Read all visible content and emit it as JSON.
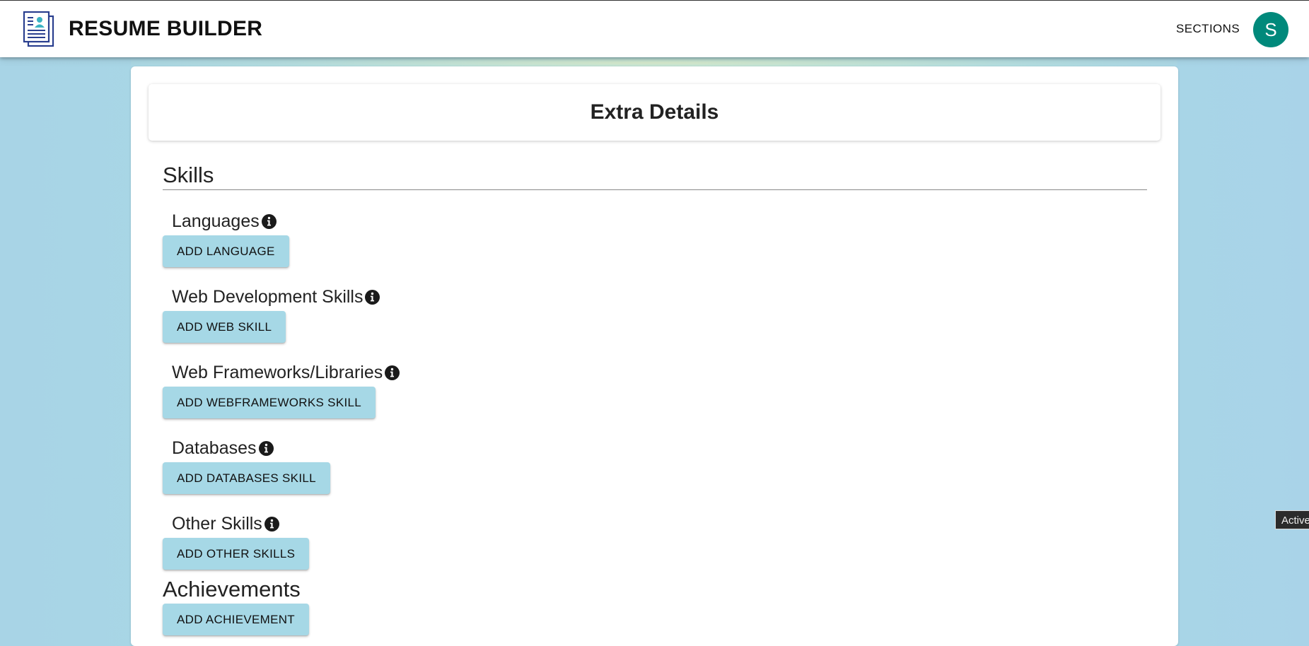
{
  "header": {
    "title": "RESUME BUILDER",
    "logo_icon": "resume-document-icon",
    "sections_label": "SECTIONS",
    "avatar_initial": "S",
    "avatar_color": "#00897b"
  },
  "page": {
    "heading": "Extra Details"
  },
  "skills": {
    "title": "Skills",
    "groups": [
      {
        "label": "Languages",
        "button": "ADD LANGUAGE"
      },
      {
        "label": "Web Development Skills",
        "button": "ADD WEB SKILL"
      },
      {
        "label": "Web Frameworks/Libraries",
        "button": "ADD WEBFRAMEWORKS SKILL"
      },
      {
        "label": "Databases",
        "button": "ADD DATABASES SKILL"
      },
      {
        "label": "Other Skills",
        "button": "ADD OTHER SKILLS"
      }
    ]
  },
  "achievements": {
    "title": "Achievements",
    "button": "ADD ACHIEVEMENT"
  },
  "tooltip": {
    "text": "Active"
  },
  "colors": {
    "button_bg": "#a6d8e6",
    "background": "#a7dbe3"
  }
}
